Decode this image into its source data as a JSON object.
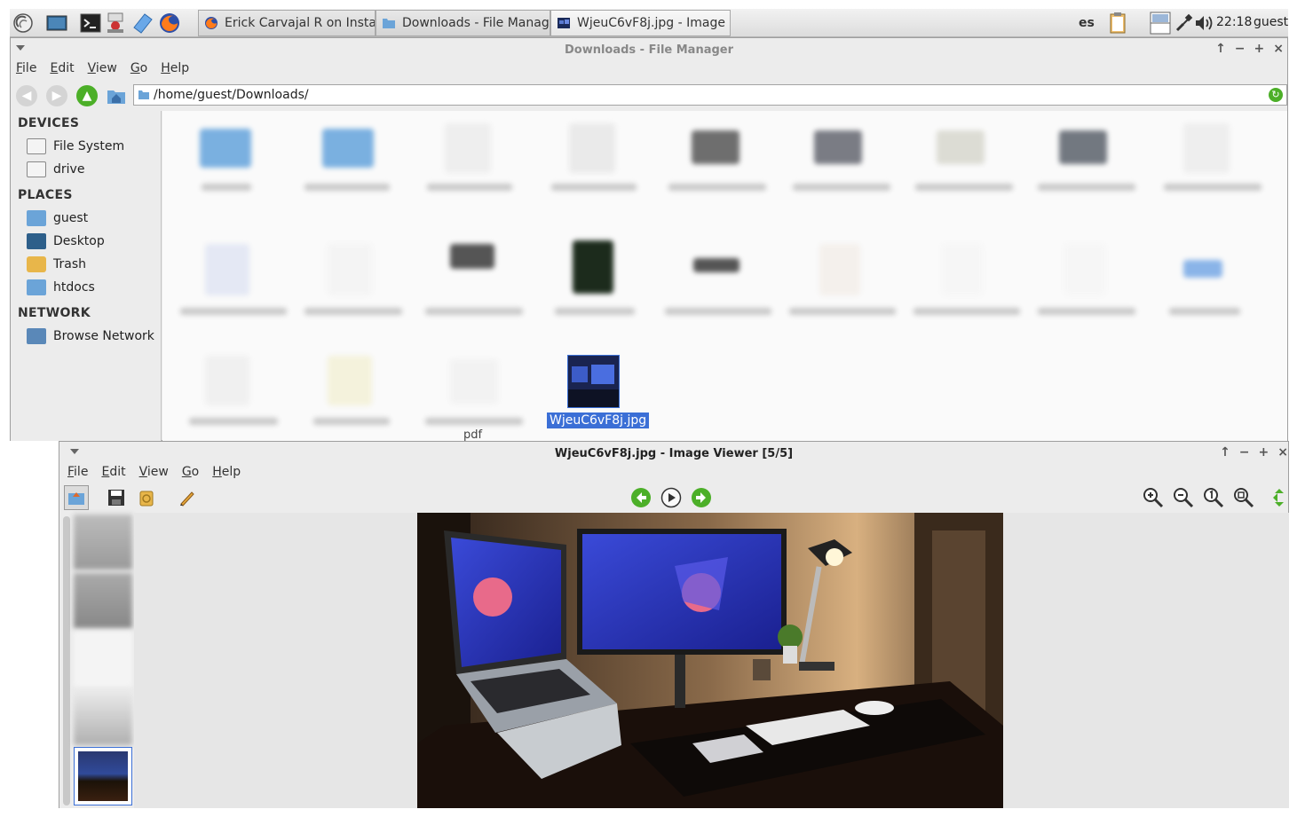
{
  "taskbar": {
    "tasks": [
      {
        "label": "Erick Carvajal R on Insta..."
      },
      {
        "label": "Downloads - File Manager"
      },
      {
        "label": "WjeuC6vF8j.jpg - Image ..."
      }
    ],
    "keyboard_layout": "es",
    "clock": "22:18",
    "user": "guest"
  },
  "file_manager": {
    "title": "Downloads - File Manager",
    "menu": [
      "File",
      "Edit",
      "View",
      "Go",
      "Help"
    ],
    "path": "/home/guest/Downloads/",
    "sidebar": {
      "devices_heading": "DEVICES",
      "devices": [
        {
          "label": "File System"
        },
        {
          "label": "drive"
        }
      ],
      "places_heading": "PLACES",
      "places": [
        {
          "label": "guest"
        },
        {
          "label": "Desktop"
        },
        {
          "label": "Trash"
        },
        {
          "label": "htdocs"
        }
      ],
      "network_heading": "NETWORK",
      "network": [
        {
          "label": "Browse Network"
        }
      ]
    },
    "selected_file": "WjeuC6vF8j.jpg",
    "partial_label": "pdf"
  },
  "image_viewer": {
    "title": "WjeuC6vF8j.jpg - Image Viewer [5/5]",
    "menu": [
      "File",
      "Edit",
      "View",
      "Go",
      "Help"
    ]
  },
  "colors": {
    "selection": "#3b6fd6",
    "accent_green": "#4caf28"
  }
}
